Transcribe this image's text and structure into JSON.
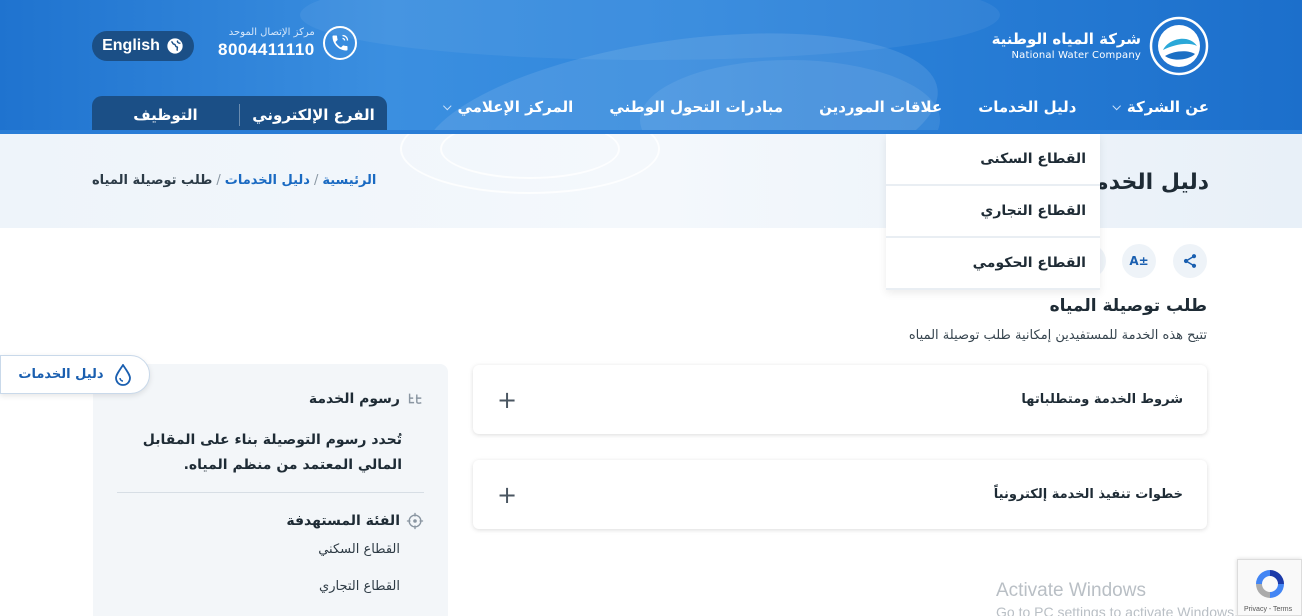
{
  "header": {
    "logo_ar": "شركة المياه الوطنية",
    "logo_en": "National Water Company",
    "callcenter_label": "مركز الإتصال الموحد",
    "callcenter_number": "8004411110",
    "language_button": "English"
  },
  "nav": {
    "items": [
      {
        "label": "عن الشركة",
        "has_chevron": true
      },
      {
        "label": "دليل الخدمات",
        "has_chevron": false
      },
      {
        "label": "علاقات الموردين",
        "has_chevron": false
      },
      {
        "label": "مبادرات التحول الوطني",
        "has_chevron": false
      },
      {
        "label": "المركز الإعلامي",
        "has_chevron": true
      }
    ],
    "quick_tabs": [
      "الفرع الإلكتروني",
      "التوظيف"
    ]
  },
  "dropdown": {
    "items": [
      "القطاع السكنى",
      "القطاع التجاري",
      "القطاع الحكومي"
    ]
  },
  "page": {
    "title": "دليل الخدمات",
    "breadcrumb": [
      "الرئيسية",
      "دليل الخدمات",
      "طلب توصيلة المياه"
    ],
    "font_tool": "A±",
    "service_title": "طلب توصيلة المياه",
    "service_desc": "تتيح هذه الخدمة للمستفيدين إمكانية طلب توصيلة المياه"
  },
  "accordions": [
    {
      "label": "شروط الخدمة ومتطلباتها",
      "icon": "+"
    },
    {
      "label": "خطوات تنفيذ الخدمة إلكترونياً",
      "icon": "+"
    }
  ],
  "side_card": {
    "fees_title": "رسوم الخدمة",
    "fees_text": "تُحدد رسوم التوصيلة بناء على المقابل المالي المعتمد من منظم المياه.",
    "audience_title": "الفئة المستهدفة",
    "audience": [
      "القطاع السكني",
      "القطاع التجاري"
    ]
  },
  "floating": {
    "guide_label": "دليل الخدمات"
  },
  "watermark": {
    "line1": "Activate Windows",
    "line2": "Go to PC settings to activate Windows."
  },
  "recaptcha": {
    "links": "Privacy - Terms"
  },
  "colors": {
    "brand_blue": "#1f73cf",
    "dark_blue": "#1b4f86",
    "link_blue": "#1a6ac2"
  }
}
